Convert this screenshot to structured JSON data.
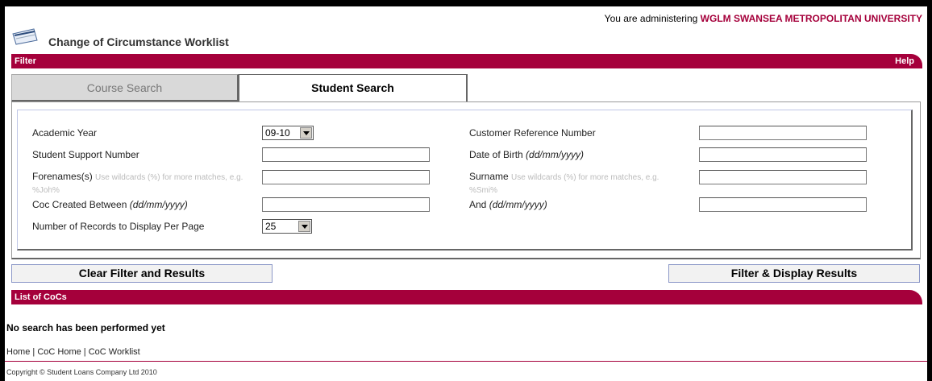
{
  "header": {
    "admin_prefix": "You are administering",
    "institution": "WGLM SWANSEA METROPOLITAN UNIVERSITY",
    "page_title": "Change of Circumstance Worklist",
    "title_icon": "worklist-icon"
  },
  "filter_bar": {
    "label": "Filter",
    "help": "Help"
  },
  "tabs": [
    {
      "label": "Course Search",
      "active": false
    },
    {
      "label": "Student Search",
      "active": true
    }
  ],
  "form": {
    "academic_year_label": "Academic Year",
    "academic_year_value": "09-10",
    "ssn_label": "Student Support Number",
    "ssn_value": "",
    "forenames_label": "Forenames(s)",
    "forenames_hint": "Use wildcards (%) for more matches, e.g. %Joh%",
    "forenames_value": "",
    "coc_created_label": "Coc Created Between",
    "coc_created_format": "(dd/mm/yyyy)",
    "coc_created_value": "",
    "records_label": "Number of Records to Display Per Page",
    "records_value": "25",
    "crn_label": "Customer Reference Number",
    "crn_value": "",
    "dob_label": "Date of Birth",
    "dob_format": "(dd/mm/yyyy)",
    "dob_value": "",
    "surname_label": "Surname",
    "surname_hint": "Use wildcards (%) for more matches, e.g. %Smi%",
    "surname_value": "",
    "and_label": "And",
    "and_format": "(dd/mm/yyyy)",
    "and_value": ""
  },
  "buttons": {
    "clear": "Clear Filter and Results",
    "filter": "Filter & Display Results"
  },
  "list_bar": {
    "label": "List of CoCs"
  },
  "results": {
    "message": "No search has been performed yet"
  },
  "footer": {
    "links": [
      "Home",
      "CoC Home",
      "CoC Worklist"
    ],
    "separator": "|",
    "copyright": "Copyright © Student Loans Company Ltd 2010"
  },
  "colors": {
    "brand": "#a5003b"
  }
}
